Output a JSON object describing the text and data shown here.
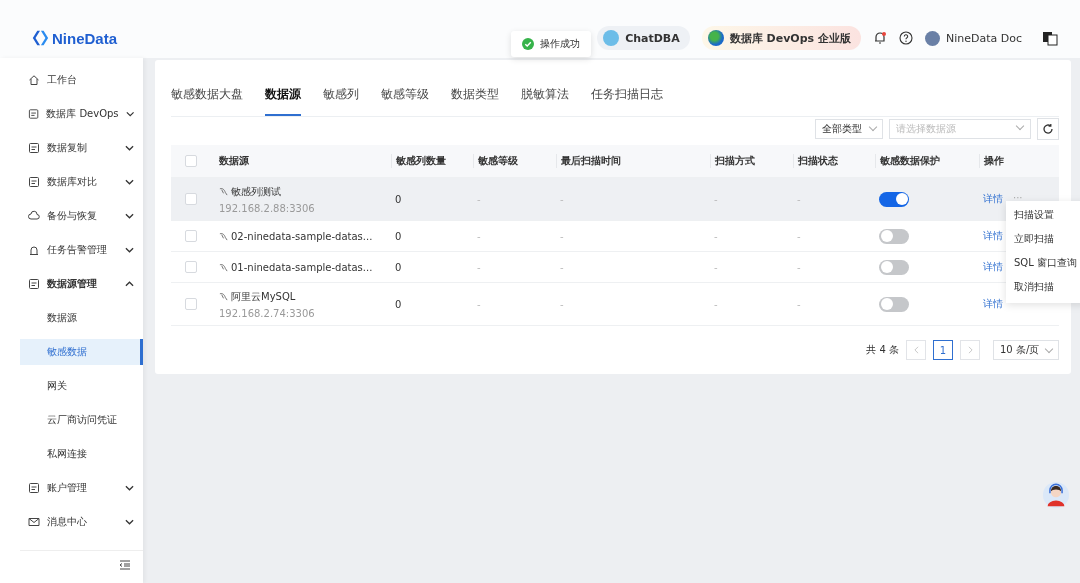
{
  "header": {
    "logo": "NineData",
    "toast": "操作成功",
    "chat_button": "ChatDBA",
    "edition_button": "数据库 DevOps 企业版",
    "notification_dot": true,
    "user": "NineData Doc"
  },
  "sidebar": {
    "items": [
      {
        "label": "工作台"
      },
      {
        "label": "数据库 DevOps",
        "expanded": false
      },
      {
        "label": "数据复制",
        "expanded": false
      },
      {
        "label": "数据库对比",
        "expanded": false
      },
      {
        "label": "备份与恢复",
        "expanded": false
      },
      {
        "label": "任务告警管理",
        "expanded": false
      },
      {
        "label": "数据源管理",
        "expanded": true,
        "children": [
          {
            "label": "数据源",
            "selected": false
          },
          {
            "label": "敏感数据",
            "selected": true
          },
          {
            "label": "网关",
            "selected": false
          },
          {
            "label": "云厂商访问凭证",
            "selected": false
          },
          {
            "label": "私网连接",
            "selected": false
          }
        ]
      },
      {
        "label": "账户管理",
        "expanded": false
      },
      {
        "label": "消息中心",
        "expanded": false
      }
    ]
  },
  "tabs": [
    {
      "label": "敏感数据大盘",
      "selected": false
    },
    {
      "label": "数据源",
      "selected": true
    },
    {
      "label": "敏感列",
      "selected": false
    },
    {
      "label": "敏感等级",
      "selected": false
    },
    {
      "label": "数据类型",
      "selected": false
    },
    {
      "label": "脱敏算法",
      "selected": false
    },
    {
      "label": "任务扫描日志",
      "selected": false
    }
  ],
  "filters": {
    "type_select": "全部类型",
    "source_select": {
      "placeholder": "请选择数据源"
    }
  },
  "table": {
    "all_checked": false,
    "columns": [
      "数据源",
      "敏感列数量",
      "敏感等级",
      "最后扫描时间",
      "扫描方式",
      "扫描状态",
      "敏感数据保护",
      "操作"
    ],
    "rows": [
      {
        "name": "敏感列测试",
        "host": "192.168.2.88:3306",
        "count": "0",
        "level": "-",
        "last_scan": "-",
        "method": "-",
        "status": "-",
        "protection": true,
        "action": "详情",
        "more": "···",
        "checked": false,
        "highlighted": true
      },
      {
        "name": "02-ninedata-sample-datas...",
        "count": "0",
        "level": "-",
        "last_scan": "-",
        "method": "-",
        "status": "-",
        "protection": false,
        "action": "详情",
        "checked": false,
        "highlighted": false
      },
      {
        "name": "01-ninedata-sample-datas...",
        "count": "0",
        "level": "-",
        "last_scan": "-",
        "method": "-",
        "status": "-",
        "protection": false,
        "action": "详情",
        "checked": false,
        "highlighted": false
      },
      {
        "name": "阿里云MySQL",
        "host": "192.168.2.74:3306",
        "count": "0",
        "level": "-",
        "last_scan": "-",
        "method": "-",
        "status": "-",
        "protection": false,
        "action": "详情",
        "checked": false,
        "highlighted": false
      }
    ]
  },
  "row_menu": {
    "items": [
      "扫描设置",
      "立即扫描",
      "SQL 窗口查询",
      "取消扫描"
    ]
  },
  "pagination": {
    "total": "共 4 条",
    "pages": [
      {
        "label": "1",
        "selected": true
      }
    ],
    "page_size": "10 条/页"
  }
}
